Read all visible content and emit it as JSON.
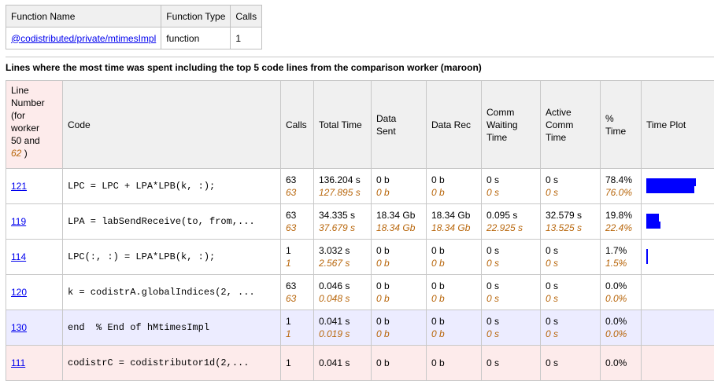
{
  "function_table": {
    "headers": [
      "Function Name",
      "Function Type",
      "Calls"
    ],
    "row": {
      "name": "@codistributed/private/mtimesImpl",
      "type": "function",
      "calls": "1"
    }
  },
  "section_heading": "Lines where the most time was spent including the top 5 code lines from the comparison worker (maroon)",
  "table": {
    "headers": {
      "line_number_lines": [
        "Line",
        "Number",
        "(for",
        "worker",
        "50 and"
      ],
      "line_number_comparison": "62",
      "line_number_suffix": ")",
      "code": "Code",
      "calls": "Calls",
      "total_time": "Total Time",
      "data_sent_1": "Data",
      "data_sent_2": "Sent",
      "data_rec": "Data Rec",
      "comm_waiting_1": "Comm",
      "comm_waiting_2": "Waiting",
      "comm_waiting_3": "Time",
      "active_comm_1": "Active",
      "active_comm_2": "Comm",
      "active_comm_3": "Time",
      "pct_time_1": "%",
      "pct_time_2": "Time",
      "time_plot": "Time Plot"
    },
    "rows": [
      {
        "line": "121",
        "code": "LPC = LPC + LPA*LPB(k, :);",
        "calls": "63",
        "calls_cmp": "63",
        "total": "136.204 s",
        "total_cmp": "127.895 s",
        "sent": "0 b",
        "sent_cmp": "0 b",
        "rec": "0 b",
        "rec_cmp": "0 b",
        "wait": "0 s",
        "wait_cmp": "0 s",
        "active": "0 s",
        "active_cmp": "0 s",
        "pct": "78.4%",
        "pct_cmp": "76.0%",
        "plot": 78.4,
        "plot_cmp": 76.0
      },
      {
        "line": "119",
        "code": "LPA = labSendReceive(to, from,...",
        "calls": "63",
        "calls_cmp": "63",
        "total": "34.335 s",
        "total_cmp": "37.679 s",
        "sent": "18.34 Gb",
        "sent_cmp": "18.34 Gb",
        "rec": "18.34 Gb",
        "rec_cmp": "18.34 Gb",
        "wait": "0.095 s",
        "wait_cmp": "22.925 s",
        "active": "32.579 s",
        "active_cmp": "13.525 s",
        "pct": "19.8%",
        "pct_cmp": "22.4%",
        "plot": 19.8,
        "plot_cmp": 22.4
      },
      {
        "line": "114",
        "code": "LPC(:, :) = LPA*LPB(k, :);",
        "calls": "1",
        "calls_cmp": "1",
        "total": "3.032 s",
        "total_cmp": "2.567 s",
        "sent": "0 b",
        "sent_cmp": "0 b",
        "rec": "0 b",
        "rec_cmp": "0 b",
        "wait": "0 s",
        "wait_cmp": "0 s",
        "active": "0 s",
        "active_cmp": "0 s",
        "pct": "1.7%",
        "pct_cmp": "1.5%",
        "plot": 1.7,
        "plot_cmp": 1.5
      },
      {
        "line": "120",
        "code": "k = codistrA.globalIndices(2, ...",
        "calls": "63",
        "calls_cmp": "63",
        "total": "0.046 s",
        "total_cmp": "0.048 s",
        "sent": "0 b",
        "sent_cmp": "0 b",
        "rec": "0 b",
        "rec_cmp": "0 b",
        "wait": "0 s",
        "wait_cmp": "0 s",
        "active": "0 s",
        "active_cmp": "0 s",
        "pct": "0.0%",
        "pct_cmp": "0.0%",
        "plot": 0,
        "plot_cmp": 0
      },
      {
        "line": "130",
        "code": "end  % End of hMtimesImpl",
        "calls": "1",
        "calls_cmp": "1",
        "total": "0.041 s",
        "total_cmp": "0.019 s",
        "sent": "0 b",
        "sent_cmp": "0 b",
        "rec": "0 b",
        "rec_cmp": "0 b",
        "wait": "0 s",
        "wait_cmp": "0 s",
        "active": "0 s",
        "active_cmp": "0 s",
        "pct": "0.0%",
        "pct_cmp": "0.0%",
        "plot": 0,
        "plot_cmp": 0
      },
      {
        "line": "111",
        "code": "codistrC = codistributor1d(2,...",
        "calls": "1",
        "calls_cmp": "",
        "total": "0.041 s",
        "total_cmp": "",
        "sent": "0 b",
        "sent_cmp": "",
        "rec": "0 b",
        "rec_cmp": "",
        "wait": "0 s",
        "wait_cmp": "",
        "active": "0 s",
        "active_cmp": "",
        "pct": "0.0%",
        "pct_cmp": "",
        "plot": 0,
        "plot_cmp": 0
      }
    ]
  },
  "colors": {
    "comparison": "#b8660b",
    "bar": "#0000ff",
    "row_highlight_blue": "#ececff",
    "row_highlight_pink": "#fdebeb"
  }
}
